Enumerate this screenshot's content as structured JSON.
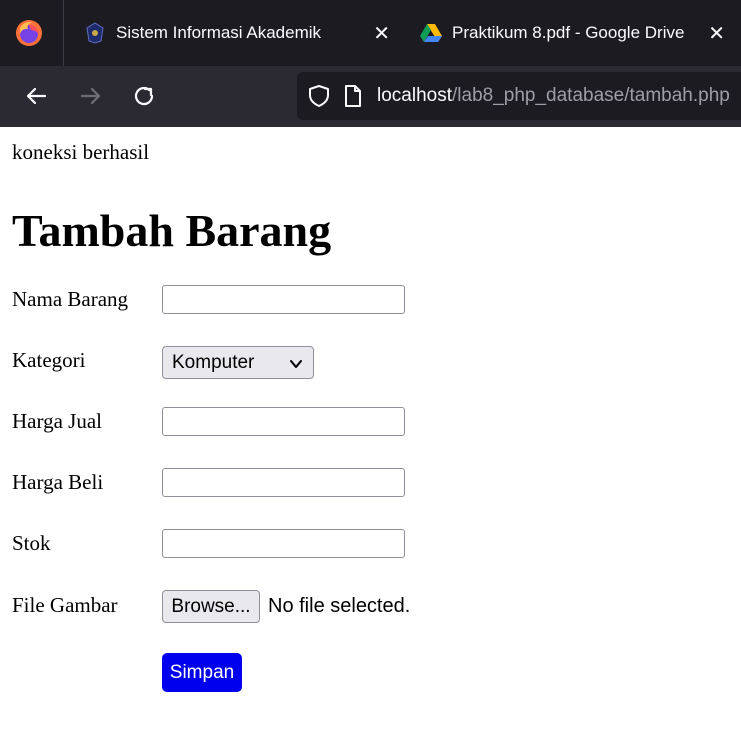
{
  "browser": {
    "tabs": [
      {
        "title": "Sistem Informasi Akademik",
        "close": "✕"
      },
      {
        "title": "Praktikum 8.pdf - Google Drive",
        "close": "✕"
      }
    ],
    "url": {
      "host": "localhost",
      "path": "/lab8_php_database/tambah.php"
    },
    "icons": {
      "app": "firefox-logo-icon",
      "back": "back-arrow-icon",
      "forward": "forward-arrow-icon",
      "reload": "reload-icon",
      "shield": "tracking-protection-shield-icon",
      "page": "page-document-icon"
    }
  },
  "page": {
    "status": "koneksi berhasil",
    "title": "Tambah Barang",
    "form": {
      "nama_label": "Nama Barang",
      "nama_value": "",
      "kategori_label": "Kategori",
      "kategori_selected": "Komputer",
      "harga_jual_label": "Harga Jual",
      "harga_jual_value": "",
      "harga_beli_label": "Harga Beli",
      "harga_beli_value": "",
      "stok_label": "Stok",
      "stok_value": "",
      "file_label": "File Gambar",
      "browse_label": "Browse...",
      "file_status": "No file selected.",
      "submit_label": "Simpan"
    }
  },
  "colors": {
    "tabbar": "#1c1b22",
    "toolbar": "#2b2a33",
    "submit": "#0000ee"
  }
}
